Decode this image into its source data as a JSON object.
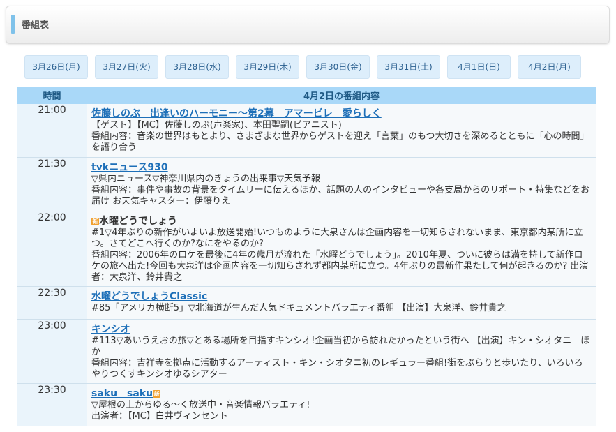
{
  "header": {
    "title": "番組表"
  },
  "date_tabs": [
    "3月26日(月)",
    "3月27日(火)",
    "3月28日(水)",
    "3月29日(木)",
    "3月30日(金)",
    "3月31日(土)",
    "4月1日(日)",
    "4月2日(月)"
  ],
  "table": {
    "col_time": "時間",
    "col_content": "4月2日の番組内容",
    "rows": [
      {
        "time": "21:00",
        "title": "佐藤しのぶ　出逢いのハーモニー〜第2幕　アマービレ　愛らしく",
        "lines": [
          "【ゲスト】【MC】佐藤しのぶ(声楽家)、本田聖嗣(ピアニスト)",
          "番組内容：音楽の世界はもとより、さまざまな世界からゲストを迎え「言葉」のもつ大切さを深めるとともに「心の時間」を語り合う"
        ]
      },
      {
        "time": "21:30",
        "title": "tvkニュース930",
        "lines": [
          "▽県内ニュース▽神奈川県内のきょうの出来事▽天気予報",
          "番組内容：事件や事故の背景をタイムリーに伝えるほか、話題の人のインタビューや各支局からのリポート・特集などをお届け お天気キャスター：伊藤りえ"
        ]
      },
      {
        "time": "22:00",
        "badge": "新",
        "title": "水曜どうでしょう",
        "lines": [
          "#1▽4年ぶりの新作がいよいよ放送開始!いつものように大泉さんは企画内容を一切知らされないまま、東京都内某所に立つ。さてどこへ行くのか?なにをやるのか?",
          "番組内容：2006年のロケを最後に4年の歳月が流れた「水曜どうでしょう」。2010年夏、ついに彼らは満を持して新作ロケの旅へ出た!今回も大泉洋は企画内容を一切知らされず都内某所に立つ。4年ぶりの最新作果たして何が起きるのか? 出演者：大泉洋、鈴井貴之"
        ]
      },
      {
        "time": "22:30",
        "title": "水曜どうでしょうClassic",
        "lines": [
          "#85「アメリカ横断5」▽北海道が生んだ人気ドキュメントバラエティ番組 【出演】大泉洋、鈴井貴之"
        ]
      },
      {
        "time": "23:00",
        "title": "キンシオ",
        "lines": [
          "#113▽あいうえおの旅▽とある場所を目指すキンシオ!企画当初から訪れたかったという街へ 【出演】キン・シオタニ　ほか",
          "番組内容：吉祥寺を拠点に活動するアーティスト・キン・シオタニ初のレギュラー番組!街をぶらりと歩いたり、いろいろやりつくすキンシオゆるシアター"
        ]
      },
      {
        "time": "23:30",
        "title": "saku　saku",
        "badge_after": "新",
        "lines": [
          "▽屋根の上からゆる〜く放送中・音楽情報バラエティ!",
          "出演者：【MC】白井ヴィンセント"
        ]
      }
    ]
  }
}
